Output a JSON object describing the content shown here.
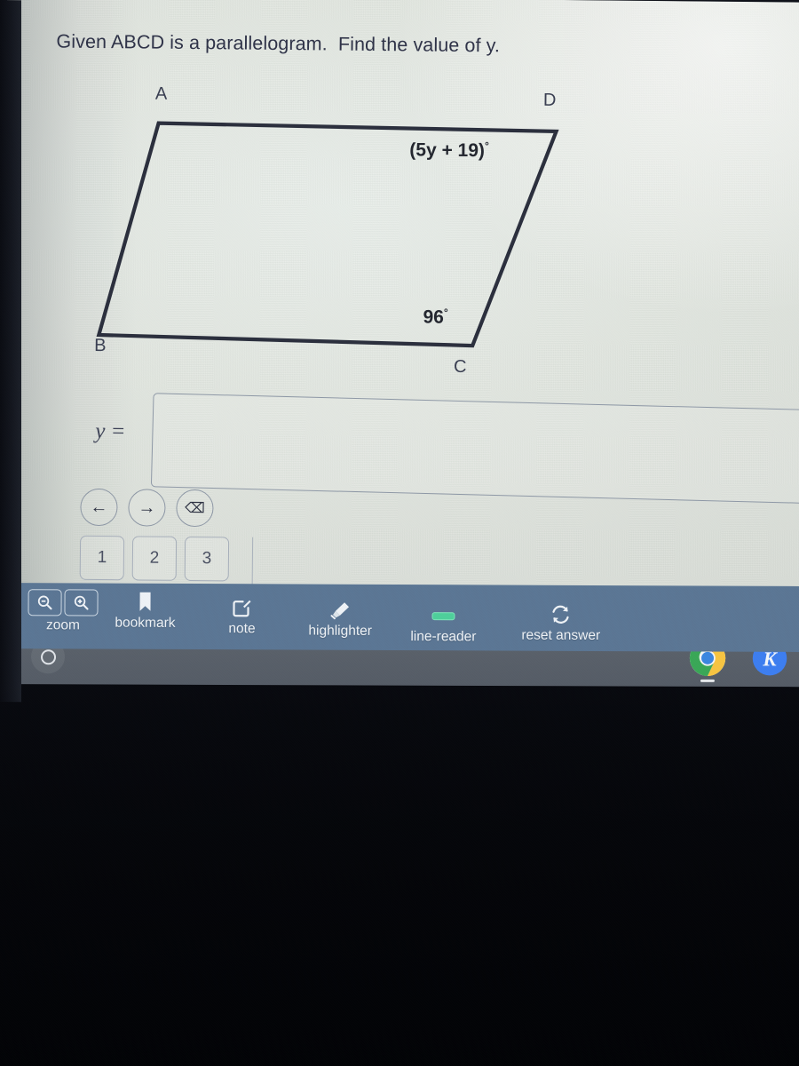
{
  "question": {
    "text": "Given ABCD is a parallelogram.  Find the value of y."
  },
  "figure": {
    "shape": "parallelogram",
    "vertex_labels": {
      "A": "A",
      "B": "B",
      "C": "C",
      "D": "D"
    },
    "angle_labels": {
      "at_D": "(5y + 19)",
      "at_D_unit": "°",
      "at_C": "96",
      "at_C_unit": "°"
    },
    "stroke_color": "#2b2f3d"
  },
  "answer": {
    "label": "y =",
    "value": "",
    "placeholder": ""
  },
  "keypad": {
    "nav": [
      {
        "name": "left-arrow",
        "glyph": "←"
      },
      {
        "name": "right-arrow",
        "glyph": "→"
      },
      {
        "name": "backspace",
        "glyph": "⌫"
      }
    ],
    "numbers": [
      "1",
      "2",
      "3"
    ]
  },
  "toolbar": {
    "background": "#5b7694",
    "items": [
      {
        "label": "zoom",
        "icon": "magnifier-minus-plus"
      },
      {
        "label": "bookmark",
        "icon": "bookmark-icon"
      },
      {
        "label": "note",
        "icon": "note-pencil-icon"
      },
      {
        "label": "highlighter",
        "icon": "highlighter-icon"
      },
      {
        "label": "line-reader",
        "icon": "line-reader-icon",
        "icon_color": "#4ecf9b"
      },
      {
        "label": "reset answer",
        "icon": "refresh-icon"
      }
    ]
  },
  "shelf": {
    "launcher": "launcher-circle",
    "apps": [
      {
        "name": "chrome",
        "label": ""
      },
      {
        "name": "kami",
        "label": "K",
        "color": "#3d7ef0"
      }
    ]
  }
}
